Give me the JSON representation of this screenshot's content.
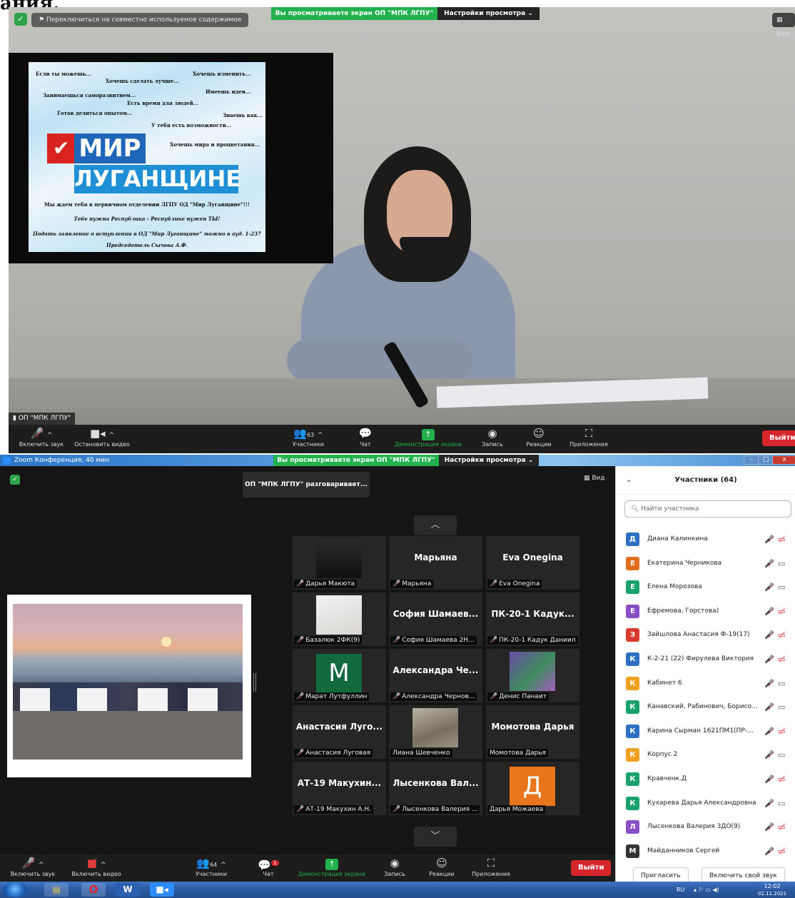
{
  "fragment_top": "ания.",
  "top": {
    "switch_btn": "Переключиться на совместно используемое содержимое",
    "viewing": "Вы просматриваете экран ОП \"МПК ЛГПУ\"",
    "view_settings": "Настройки просмотра ⌄",
    "view_btn": "Вид",
    "name_tag": "ОП \"МПК ЛГПУ\"",
    "slide": {
      "phrases": [
        "Если ты можешь...",
        "Хочешь сделать лучше...",
        "Хочешь изменить...",
        "Занимаешься саморазвитием...",
        "Имеешь идеи...",
        "Есть время для людей...",
        "Готов делиться опытом...",
        "Знаешь как...",
        "У тебя есть возможности...",
        "Хочешь мира и процветания..."
      ],
      "logo_mir": "МИР",
      "logo_lug": "ЛУГАНЩИНЕ",
      "line1": "Мы ждем тебя в первичном отделении ЛГПУ ОД \"Мир Луганщине\"!!!",
      "line2": "Тебе нужна Республика - Республике нужен ТЫ!",
      "line3": "Подать заявление о вступлении в ОД \"Мир Луганщине\" можно в ауд. 1-237",
      "line4": "Председатель Сычева А.Ф."
    },
    "toolbar": {
      "audio": "Включить звук",
      "video": "Остановить видео",
      "participants": "Участники",
      "participants_count": "63",
      "chat": "Чат",
      "share": "Демонстрация экрана",
      "record": "Запись",
      "reactions": "Реакции",
      "apps": "Приложения",
      "exit": "Выйти"
    }
  },
  "bottom": {
    "title": "Zoom Конференция, 40 мин",
    "viewing": "Вы просматриваете экран ОП \"МПК ЛГПУ\"",
    "view_settings": "Настройки просмотра ⌄",
    "talking": "ОП \"МПК ЛГПУ\" разговаривает...",
    "view_btn": "Вид",
    "tiles": [
      {
        "big": "",
        "caption": "Дарья Макюта",
        "muted": true,
        "avatar": "photo-dark"
      },
      {
        "big": "Марьяна",
        "caption": "Марьяна",
        "muted": true
      },
      {
        "big": "Eva Onegina",
        "caption": "Eva Onegina",
        "muted": true
      },
      {
        "big": "",
        "caption": "Базалюк 2ФК(9)",
        "muted": true,
        "avatar": "photo-light"
      },
      {
        "big": "София Шамаев...",
        "caption": "София Шамаева 2Н...",
        "muted": true
      },
      {
        "big": "ПК-20-1 Кадук...",
        "caption": "ПК-20-1 Кадук Даниил",
        "muted": true
      },
      {
        "big": "",
        "caption": "Марат Лутфуллин",
        "muted": true,
        "avatar": "letter-M"
      },
      {
        "big": "Александра Че...",
        "caption": "Александра Чернов...",
        "muted": true
      },
      {
        "big": "",
        "caption": "Денис Панаит",
        "muted": true,
        "avatar": "photo-purple"
      },
      {
        "big": "Анастасия Луго...",
        "caption": "Анастасия Луговая",
        "muted": true
      },
      {
        "big": "",
        "caption": "Лиана Шевченко",
        "muted": false,
        "avatar": "photo-cat"
      },
      {
        "big": "Момотова Дарья",
        "caption": "Момотова Дарья",
        "muted": false
      },
      {
        "big": "АТ-19 Макухин...",
        "caption": "АТ-19 Макухин А.Н.",
        "muted": true
      },
      {
        "big": "Лысенкова Вал...",
        "caption": "Лысенкова Валерия ...",
        "muted": true
      },
      {
        "big": "",
        "caption": "Дарья Можаева",
        "muted": false,
        "avatar": "letter-Д"
      }
    ],
    "avatar_letters": {
      "m": "M",
      "d": "Д"
    },
    "panel": {
      "title": "Участники (64)",
      "search_placeholder": "Найти участника",
      "participants": [
        {
          "initial": "Д",
          "name": "Диана Калинкина",
          "color": "#2d6fc1",
          "cam_on": false
        },
        {
          "initial": "Е",
          "name": "Екатерина Черникова",
          "color": "#e0701f",
          "cam_on": true
        },
        {
          "initial": "Е",
          "name": "Елена Морозова",
          "color": "#1aa06a",
          "cam_on": true
        },
        {
          "initial": "Е",
          "name": "Ефремова, Горстова)",
          "color": "#8a4ec4",
          "cam_on": false
        },
        {
          "initial": "З",
          "name": "Зайшлова Анастасия Ф-19(17)",
          "color": "#d93a2b",
          "cam_on": false
        },
        {
          "initial": "К",
          "name": "К-2-21 (22) Фирулева Виктория",
          "color": "#2d6fc1",
          "cam_on": false
        },
        {
          "initial": "К",
          "name": "Кабинет 6",
          "color": "#f0a020",
          "cam_on": true
        },
        {
          "initial": "К",
          "name": "Канавский, Рабинович, Борисо...",
          "color": "#1aa06a",
          "cam_on": true
        },
        {
          "initial": "К",
          "name": "Карина Сырман 1621ПМ1(ПР-...",
          "color": "#2d6fc1",
          "cam_on": false
        },
        {
          "initial": "К",
          "name": "Корпус 2",
          "color": "#f0a020",
          "cam_on": true
        },
        {
          "initial": "К",
          "name": "Кравченк.Д",
          "color": "#1aa06a",
          "cam_on": false
        },
        {
          "initial": "К",
          "name": "Кухарева Дарья Александровна",
          "color": "#1aa06a",
          "cam_on": true
        },
        {
          "initial": "Л",
          "name": "Лысенкова Валерия 3ДО(9)",
          "color": "#8a4ec4",
          "cam_on": false
        },
        {
          "initial": "М",
          "name": "Майданников Сергей",
          "color": "#333333",
          "cam_on": false
        }
      ],
      "invite": "Пригласить",
      "unmute_me": "Включить свой звук"
    },
    "toolbar": {
      "audio": "Включить звук",
      "video": "Включить видео",
      "participants": "Участники",
      "participants_count": "64",
      "chat": "Чат",
      "chat_badge": "1",
      "share": "Демонстрация экрана",
      "record": "Запись",
      "reactions": "Реакции",
      "apps": "Приложения",
      "exit": "Выйти"
    }
  },
  "taskbar": {
    "lang": "RU",
    "time": "12:02",
    "date": "02.11.2021",
    "apps": [
      "Проводник",
      "Opera",
      "Word",
      "Zoom"
    ]
  }
}
